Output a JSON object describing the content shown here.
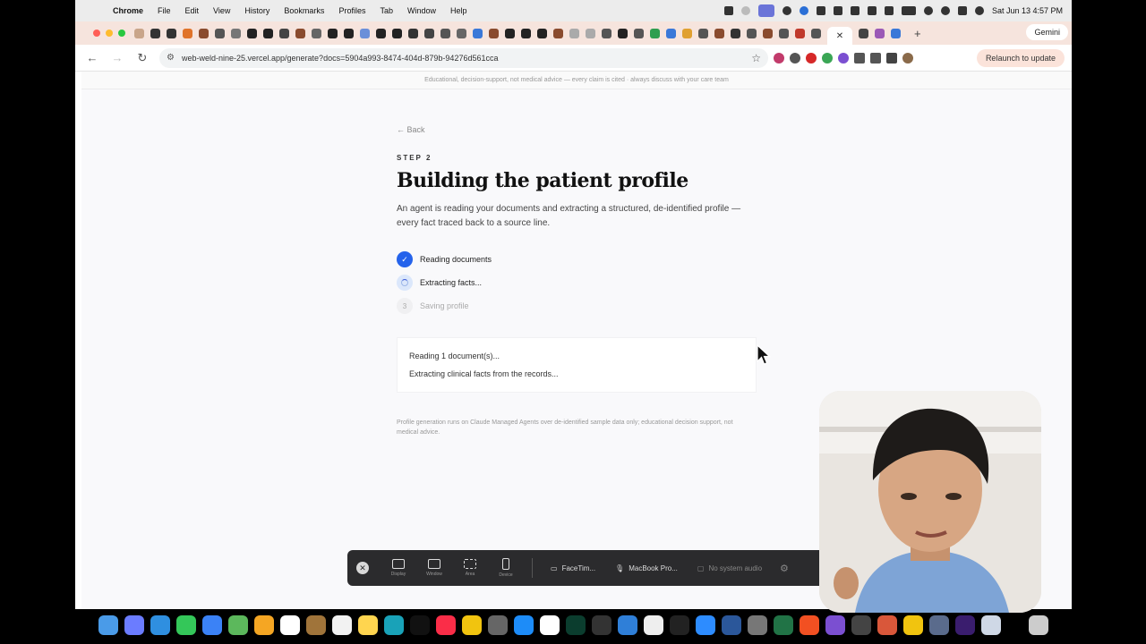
{
  "menubar": {
    "app_name": "Chrome",
    "items": [
      "File",
      "Edit",
      "View",
      "History",
      "Bookmarks",
      "Profiles",
      "Tab",
      "Window",
      "Help"
    ],
    "clock": "Sat Jun 13  4:57 PM"
  },
  "browser": {
    "url": "web-weld-nine-25.vercel.app/generate?docs=5904a993-8474-404d-879b-94276d561cca",
    "gemini_label": "Gemini",
    "relaunch_label": "Relaunch to update"
  },
  "page": {
    "disclaimer": "Educational, decision-support, not medical advice — every claim is cited · always discuss with your care team",
    "back_label": "← Back",
    "step_label": "STEP 2",
    "title": "Building the patient profile",
    "description": "An agent is reading your documents and extracting a structured, de-identified profile — every fact traced back to a source line.",
    "steps": [
      {
        "label": "Reading documents",
        "status": "done",
        "marker": "✓"
      },
      {
        "label": "Extracting facts...",
        "status": "active",
        "marker": ""
      },
      {
        "label": "Saving profile",
        "status": "pending",
        "marker": "3"
      }
    ],
    "log": [
      "Reading 1 document(s)...",
      "Extracting clinical facts from the records..."
    ],
    "footer_note": "Profile generation runs on Claude Managed Agents over de-identified sample data only; educational decision support, not medical advice."
  },
  "recorder": {
    "options": [
      "Display",
      "Window",
      "Area",
      "Device"
    ],
    "camera": "FaceTim...",
    "microphone": "MacBook Pro...",
    "system_audio": "No system audio"
  },
  "colors": {
    "accent": "#2563eb",
    "tabstrip": "#f6e4dd",
    "page_bg": "#f9f9fb"
  }
}
